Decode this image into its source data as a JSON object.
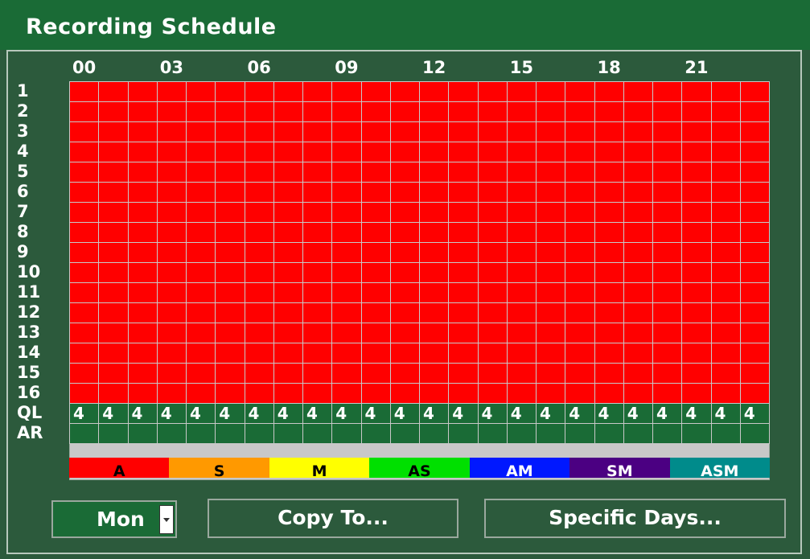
{
  "window": {
    "title": "Recording Schedule"
  },
  "hour_labels": [
    "00",
    "03",
    "06",
    "09",
    "12",
    "15",
    "18",
    "21"
  ],
  "channels": [
    "1",
    "2",
    "3",
    "4",
    "5",
    "6",
    "7",
    "8",
    "9",
    "10",
    "11",
    "12",
    "13",
    "14",
    "15",
    "16"
  ],
  "row_labels": {
    "ql": "QL",
    "ar": "AR"
  },
  "hours_count": 24,
  "schedule_mode_all": "A",
  "ql_values": [
    "4",
    "4",
    "4",
    "4",
    "4",
    "4",
    "4",
    "4",
    "4",
    "4",
    "4",
    "4",
    "4",
    "4",
    "4",
    "4",
    "4",
    "4",
    "4",
    "4",
    "4",
    "4",
    "4",
    "4"
  ],
  "legend": [
    {
      "label": "A",
      "color": "#ff0000",
      "text_color": "#000000"
    },
    {
      "label": "S",
      "color": "#ff9900",
      "text_color": "#000000"
    },
    {
      "label": "M",
      "color": "#ffff00",
      "text_color": "#000000"
    },
    {
      "label": "AS",
      "color": "#00e000",
      "text_color": "#000000"
    },
    {
      "label": "AM",
      "color": "#0018ff",
      "text_color": "#ffffff"
    },
    {
      "label": "SM",
      "color": "#4b0082",
      "text_color": "#ffffff"
    },
    {
      "label": "ASM",
      "color": "#008b8b",
      "text_color": "#ffffff"
    }
  ],
  "day_selector": {
    "value": "Mon"
  },
  "buttons": {
    "copy_to": "Copy To...",
    "specific_days": "Specific Days..."
  }
}
